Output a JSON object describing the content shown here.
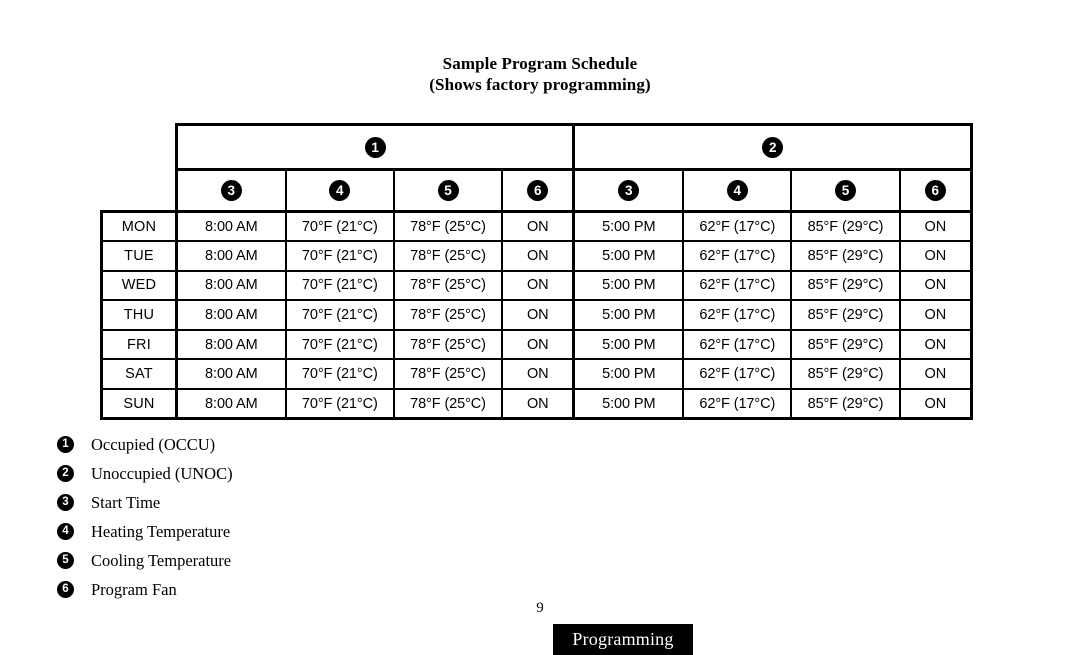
{
  "document": {
    "title_line1": "Sample Program Schedule",
    "title_line2": "(Shows factory programming)"
  },
  "table": {
    "group_headers": [
      {
        "badge": "1",
        "name": "occupied-group"
      },
      {
        "badge": "2",
        "name": "unoccupied-group"
      }
    ],
    "sub_headers": [
      {
        "badge": "3"
      },
      {
        "badge": "4"
      },
      {
        "badge": "5"
      },
      {
        "badge": "6"
      },
      {
        "badge": "3"
      },
      {
        "badge": "4"
      },
      {
        "badge": "5"
      },
      {
        "badge": "6"
      }
    ],
    "rows": [
      {
        "day": "MON",
        "occ_start": "8:00 AM",
        "occ_heat": "70°F (21°C)",
        "occ_cool": "78°F (25°C)",
        "occ_fan": "ON",
        "unocc_start": "5:00 PM",
        "unocc_heat": "62°F (17°C)",
        "unocc_cool": "85°F (29°C)",
        "unocc_fan": "ON"
      },
      {
        "day": "TUE",
        "occ_start": "8:00 AM",
        "occ_heat": "70°F (21°C)",
        "occ_cool": "78°F (25°C)",
        "occ_fan": "ON",
        "unocc_start": "5:00 PM",
        "unocc_heat": "62°F (17°C)",
        "unocc_cool": "85°F (29°C)",
        "unocc_fan": "ON"
      },
      {
        "day": "WED",
        "occ_start": "8:00 AM",
        "occ_heat": "70°F (21°C)",
        "occ_cool": "78°F (25°C)",
        "occ_fan": "ON",
        "unocc_start": "5:00 PM",
        "unocc_heat": "62°F (17°C)",
        "unocc_cool": "85°F (29°C)",
        "unocc_fan": "ON"
      },
      {
        "day": "THU",
        "occ_start": "8:00 AM",
        "occ_heat": "70°F (21°C)",
        "occ_cool": "78°F (25°C)",
        "occ_fan": "ON",
        "unocc_start": "5:00 PM",
        "unocc_heat": "62°F (17°C)",
        "unocc_cool": "85°F (29°C)",
        "unocc_fan": "ON"
      },
      {
        "day": "FRI",
        "occ_start": "8:00 AM",
        "occ_heat": "70°F (21°C)",
        "occ_cool": "78°F (25°C)",
        "occ_fan": "ON",
        "unocc_start": "5:00 PM",
        "unocc_heat": "62°F (17°C)",
        "unocc_cool": "85°F (29°C)",
        "unocc_fan": "ON"
      },
      {
        "day": "SAT",
        "occ_start": "8:00 AM",
        "occ_heat": "70°F (21°C)",
        "occ_cool": "78°F (25°C)",
        "occ_fan": "ON",
        "unocc_start": "5:00 PM",
        "unocc_heat": "62°F (17°C)",
        "unocc_cool": "85°F (29°C)",
        "unocc_fan": "ON"
      },
      {
        "day": "SUN",
        "occ_start": "8:00 AM",
        "occ_heat": "70°F (21°C)",
        "occ_cool": "78°F (25°C)",
        "occ_fan": "ON",
        "unocc_start": "5:00 PM",
        "unocc_heat": "62°F (17°C)",
        "unocc_cool": "85°F (29°C)",
        "unocc_fan": "ON"
      }
    ]
  },
  "legend": [
    {
      "badge": "1",
      "label": "Occupied (OCCU)"
    },
    {
      "badge": "2",
      "label": "Unoccupied (UNOC)"
    },
    {
      "badge": "3",
      "label": "Start Time"
    },
    {
      "badge": "4",
      "label": "Heating Temperature"
    },
    {
      "badge": "5",
      "label": "Cooling Temperature"
    },
    {
      "badge": "6",
      "label": "Program Fan"
    }
  ],
  "footer": {
    "page_number": "9",
    "section_tab": "Programming"
  },
  "colors": {
    "ink": "#000000",
    "paper": "#ffffff",
    "badge_fill": "#000000",
    "badge_text": "#ffffff"
  }
}
